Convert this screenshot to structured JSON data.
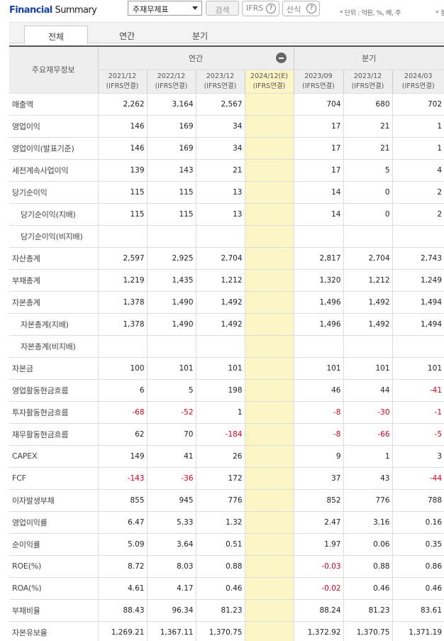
{
  "header": {
    "title_part1": "Financial",
    "title_part2": "Summary",
    "select_value": "주재무제표",
    "search_label": "검색",
    "ifrs_label": "IFRS",
    "formula_label": "산식",
    "help_glyph": "?",
    "unit_text": "* 단위 : 억원, %, 배, 주",
    "unit_text2": "* 분"
  },
  "tabs": [
    "전체",
    "연간",
    "분기"
  ],
  "table": {
    "corner_label": "주요재무정보",
    "group_annual": "연간",
    "group_quarter": "분기",
    "columns": [
      {
        "period": "2021/12",
        "basis": "(IFRS연결)"
      },
      {
        "period": "2022/12",
        "basis": "(IFRS연결)"
      },
      {
        "period": "2023/12",
        "basis": "(IFRS연결)"
      },
      {
        "period": "2024/12(E)",
        "basis": "(IFRS연결)"
      },
      {
        "period": "2023/09",
        "basis": "(IFRS연결)"
      },
      {
        "period": "2023/12",
        "basis": "(IFRS연결)"
      },
      {
        "period": "2024/03",
        "basis": "(IFRS연결)"
      }
    ],
    "rows": [
      {
        "label": "매출액",
        "indent": false,
        "values": [
          "2,262",
          "3,164",
          "2,567",
          "",
          "704",
          "680",
          "702"
        ]
      },
      {
        "label": "영업이익",
        "indent": false,
        "values": [
          "146",
          "169",
          "34",
          "",
          "17",
          "21",
          "1"
        ]
      },
      {
        "label": "영업이익(발표기준)",
        "indent": false,
        "values": [
          "146",
          "169",
          "34",
          "",
          "17",
          "21",
          "1"
        ]
      },
      {
        "label": "세전계속사업이익",
        "indent": false,
        "values": [
          "139",
          "143",
          "21",
          "",
          "17",
          "5",
          "4"
        ]
      },
      {
        "label": "당기순이익",
        "indent": false,
        "values": [
          "115",
          "115",
          "13",
          "",
          "14",
          "0",
          "2"
        ]
      },
      {
        "label": "당기순이익(지배)",
        "indent": true,
        "values": [
          "115",
          "115",
          "13",
          "",
          "14",
          "0",
          "2"
        ]
      },
      {
        "label": "당기순이익(비지배)",
        "indent": true,
        "values": [
          "",
          "",
          "",
          "",
          "",
          "",
          ""
        ]
      },
      {
        "label": "자산총계",
        "indent": false,
        "values": [
          "2,597",
          "2,925",
          "2,704",
          "",
          "2,817",
          "2,704",
          "2,743"
        ]
      },
      {
        "label": "부채총계",
        "indent": false,
        "values": [
          "1,219",
          "1,435",
          "1,212",
          "",
          "1,320",
          "1,212",
          "1,249"
        ]
      },
      {
        "label": "자본총계",
        "indent": false,
        "values": [
          "1,378",
          "1,490",
          "1,492",
          "",
          "1,496",
          "1,492",
          "1,494"
        ]
      },
      {
        "label": "자본총계(지배)",
        "indent": true,
        "values": [
          "1,378",
          "1,490",
          "1,492",
          "",
          "1,496",
          "1,492",
          "1,494"
        ]
      },
      {
        "label": "자본총계(비지배)",
        "indent": true,
        "values": [
          "",
          "",
          "",
          "",
          "",
          "",
          ""
        ]
      },
      {
        "label": "자본금",
        "indent": false,
        "values": [
          "100",
          "101",
          "101",
          "",
          "101",
          "101",
          "101"
        ]
      },
      {
        "label": "영업활동현금흐름",
        "indent": false,
        "values": [
          "6",
          "5",
          "198",
          "",
          "46",
          "44",
          "-41"
        ]
      },
      {
        "label": "투자활동현금흐름",
        "indent": false,
        "values": [
          "-68",
          "-52",
          "1",
          "",
          "-8",
          "-30",
          "-1"
        ]
      },
      {
        "label": "재무활동현금흐름",
        "indent": false,
        "values": [
          "62",
          "70",
          "-184",
          "",
          "-8",
          "-66",
          "-5"
        ]
      },
      {
        "label": "CAPEX",
        "indent": false,
        "values": [
          "149",
          "41",
          "26",
          "",
          "9",
          "1",
          "3"
        ]
      },
      {
        "label": "FCF",
        "indent": false,
        "values": [
          "-143",
          "-36",
          "172",
          "",
          "37",
          "43",
          "-44"
        ]
      },
      {
        "label": "이자발생부채",
        "indent": false,
        "values": [
          "855",
          "945",
          "776",
          "",
          "852",
          "776",
          "788"
        ]
      },
      {
        "label": "영업이익률",
        "indent": false,
        "values": [
          "6.47",
          "5.33",
          "1.32",
          "",
          "2.47",
          "3.16",
          "0.16"
        ]
      },
      {
        "label": "순이익률",
        "indent": false,
        "values": [
          "5.09",
          "3.64",
          "0.51",
          "",
          "1.97",
          "0.06",
          "0.35"
        ]
      },
      {
        "label": "ROE(%)",
        "indent": false,
        "values": [
          "8.72",
          "8.03",
          "0.88",
          "",
          "-0.03",
          "0.88",
          "0.86"
        ]
      },
      {
        "label": "ROA(%)",
        "indent": false,
        "values": [
          "4.61",
          "4.17",
          "0.46",
          "",
          "-0.02",
          "0.46",
          "0.46"
        ]
      },
      {
        "label": "부채비율",
        "indent": false,
        "values": [
          "88.43",
          "96.34",
          "81.23",
          "",
          "88.24",
          "81.23",
          "83.61"
        ]
      },
      {
        "label": "자본유보율",
        "indent": false,
        "values": [
          "1,269.21",
          "1,367.11",
          "1,370.75",
          "",
          "1,372.92",
          "1,370.75",
          "1,371.19"
        ]
      }
    ]
  }
}
